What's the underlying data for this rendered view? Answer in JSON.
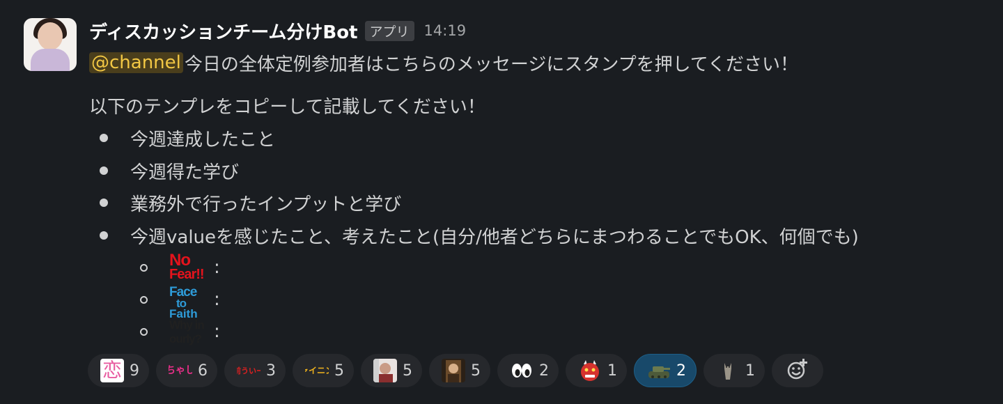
{
  "message": {
    "sender": "ディスカッションチーム分けBot",
    "app_badge": "アプリ",
    "time": "14:19",
    "mention": "@channel",
    "line1_text": "今日の全体定例参加者はこちらのメッセージにスタンプを押してください！",
    "line2_text": "以下のテンプレをコピーして記載してください！",
    "bullets": [
      "今週達成したこと",
      "今週得た学び",
      "業務外で行ったインプットと学び",
      "今週valueを感じたこと、考えたこと(自分/他者どちらにまつわることでもOK、何個でも)"
    ],
    "sub_items": [
      {
        "stamp_line1": "No",
        "stamp_line2": "Fear!!",
        "colon": ":"
      },
      {
        "stamp_line1": "Face",
        "stamp_line2": "to",
        "stamp_line3": "Faith",
        "colon": ":"
      },
      {
        "stamp_line1": "Why in",
        "stamp_line2": "ourly?",
        "colon": ":"
      }
    ]
  },
  "reactions": [
    {
      "emoji_text": "恋",
      "count": "9",
      "active": false
    },
    {
      "emoji_text": "ちゃし",
      "count": "6",
      "active": false
    },
    {
      "emoji_text": "気前ういーね",
      "count": "3",
      "active": false
    },
    {
      "emoji_text": "シャイニング",
      "count": "5",
      "active": false
    },
    {
      "emoji_text": "",
      "emoji_icon": "person-photo-icon",
      "count": "5",
      "active": false
    },
    {
      "emoji_text": "",
      "emoji_icon": "portrait-photo-icon",
      "count": "5",
      "active": false
    },
    {
      "emoji_text": "👀",
      "count": "2",
      "active": false
    },
    {
      "emoji_text": "👹",
      "count": "1",
      "active": false
    },
    {
      "emoji_text": "",
      "emoji_icon": "tank-icon",
      "count": "2",
      "active": true
    },
    {
      "emoji_text": "",
      "emoji_icon": "cat-icon",
      "count": "1",
      "active": false
    }
  ],
  "colors": {
    "background": "#1a1d21",
    "mention_bg": "#4a3e1c",
    "mention_text": "#f2c744",
    "active_reaction_bg": "#18496a"
  }
}
